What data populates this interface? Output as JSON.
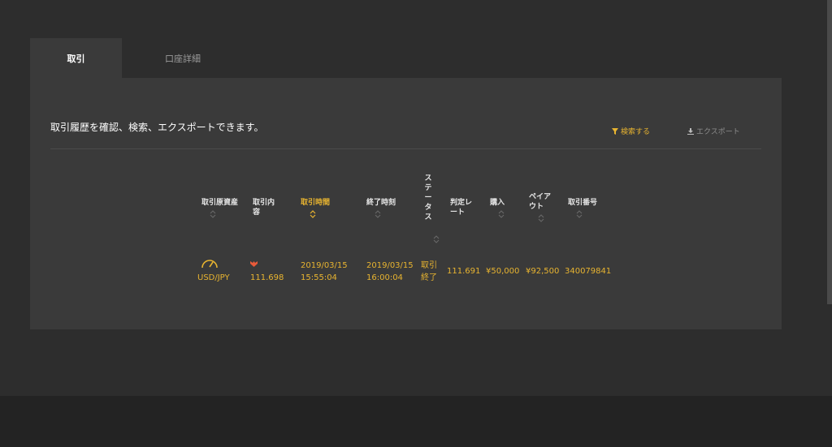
{
  "tabs": [
    {
      "label": "取引",
      "active": true
    },
    {
      "label": "口座詳細",
      "active": false
    }
  ],
  "description": "取引履歴を確認、検索、エクスポートできます。",
  "actions": {
    "search_label": "検索する",
    "export_label": "エクスポート"
  },
  "table": {
    "headers": {
      "asset": "取引原資産",
      "content_l1": "取引内",
      "content_l2": "容",
      "start_time": "取引時間",
      "end_time": "終了時刻",
      "status": [
        "ス",
        "テ",
        "ー",
        "タ",
        "ス"
      ],
      "rate_l1": "判定レ",
      "rate_l2": "ート",
      "purchase": "購入",
      "payout_l1": "ペイア",
      "payout_l2": "ウト",
      "trade_no": "取引番号"
    },
    "rows": [
      {
        "asset": "USD/JPY",
        "entry_rate": "111.698",
        "start_date": "2019/03/15",
        "start_clock": "15:55:04",
        "end_date": "2019/03/15",
        "end_clock": "16:00:04",
        "status_l1": "取引",
        "status_l2": "終了",
        "judge_rate": "111.691",
        "purchase": "¥50,000",
        "payout": "¥92,500",
        "trade_no": "340079841"
      }
    ]
  },
  "colors": {
    "accent": "#e8b430",
    "down_marker": "#e85a3a",
    "background": "#2d2d2d",
    "panel": "#3a3a3a"
  }
}
